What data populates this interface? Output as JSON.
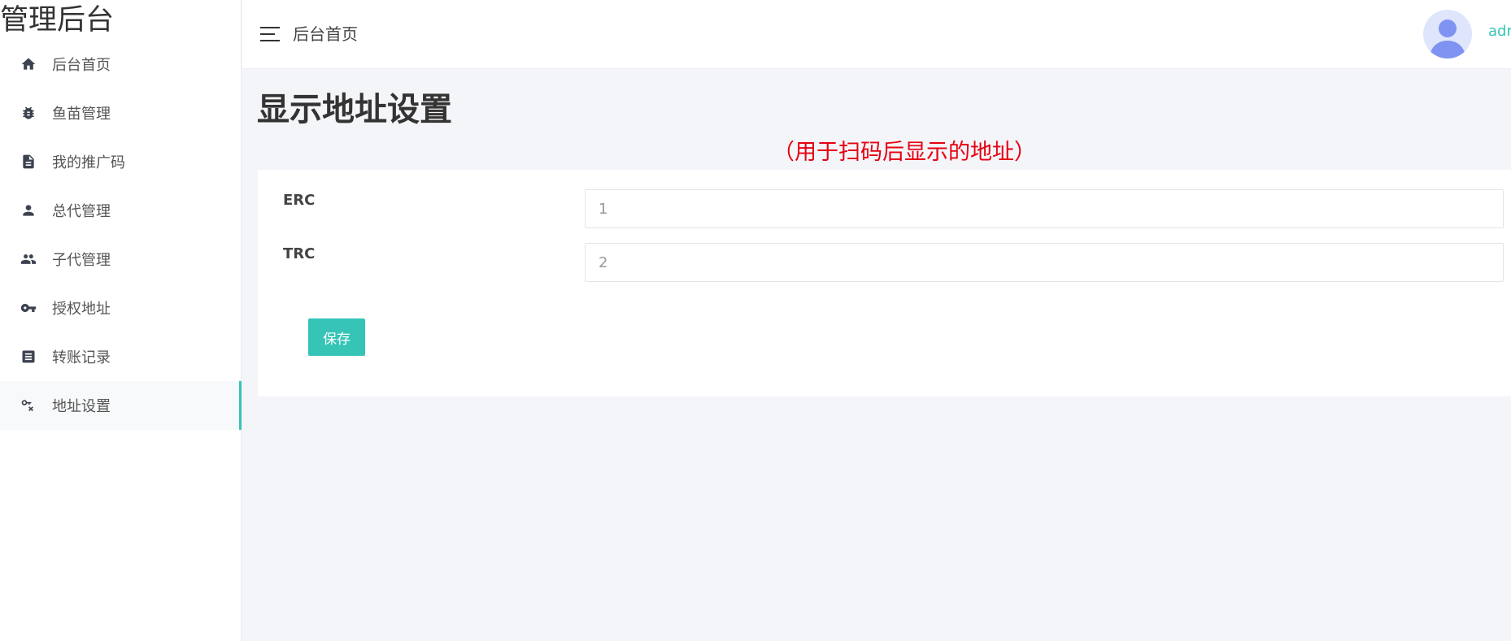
{
  "brand": {
    "title": "管理后台"
  },
  "sidebar": {
    "items": [
      {
        "label": "后台首页",
        "icon": "home-icon"
      },
      {
        "label": "鱼苗管理",
        "icon": "bug-icon"
      },
      {
        "label": "我的推广码",
        "icon": "document-icon"
      },
      {
        "label": "总代管理",
        "icon": "person-icon"
      },
      {
        "label": "子代管理",
        "icon": "people-icon"
      },
      {
        "label": "授权地址",
        "icon": "key-icon"
      },
      {
        "label": "转账记录",
        "icon": "list-icon"
      },
      {
        "label": "地址设置",
        "icon": "key-off-icon",
        "active": true
      }
    ]
  },
  "header": {
    "breadcrumb": "后台首页",
    "user_name": "adm"
  },
  "main": {
    "title": "显示地址设置",
    "note": "（用于扫码后显示的地址）",
    "fields": [
      {
        "label": "ERC",
        "value": "1"
      },
      {
        "label": "TRC",
        "value": "2"
      }
    ],
    "save_label": "保存"
  },
  "colors": {
    "accent": "#35c4b6",
    "note_red": "#e60012",
    "page_bg": "#f4f5f8"
  }
}
